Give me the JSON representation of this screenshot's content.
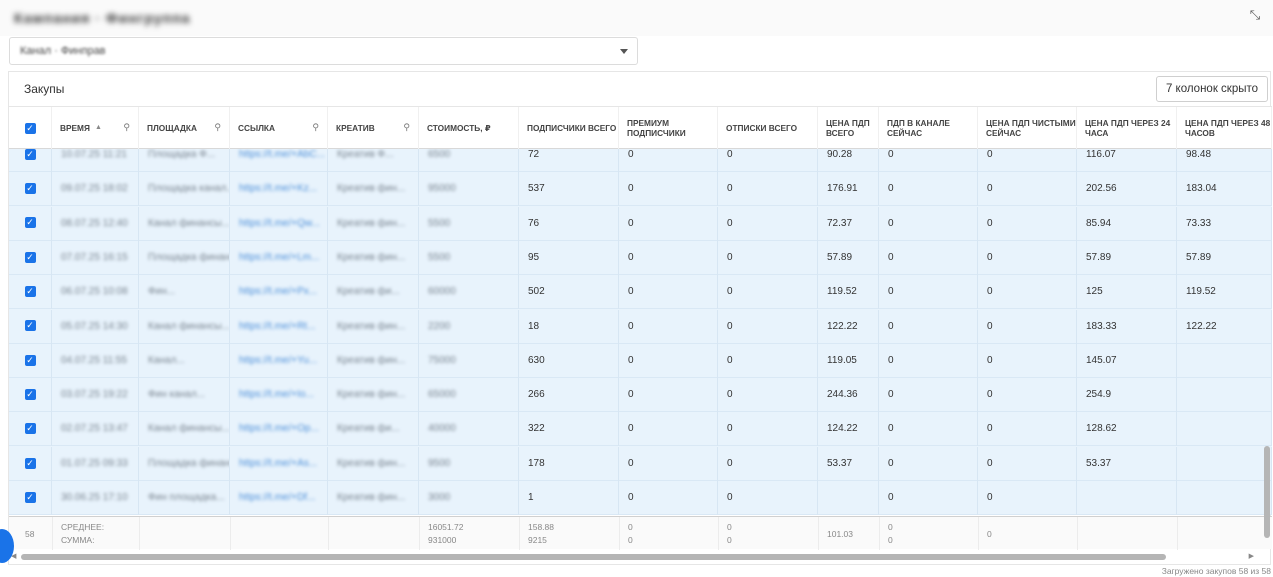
{
  "window": {
    "title": "Кампания · Фингруппа"
  },
  "channel_select": {
    "value": "Канал · Финправ"
  },
  "panel": {
    "title": "Закупы",
    "hidden_columns_button": "7 колонок скрыто"
  },
  "columns": [
    {
      "key": "select",
      "label": ""
    },
    {
      "key": "time",
      "label": "ВРЕМЯ",
      "sortable": true,
      "searchable": true
    },
    {
      "key": "platform",
      "label": "ПЛОЩАДКА",
      "searchable": true
    },
    {
      "key": "link",
      "label": "ССЫЛКА",
      "searchable": true
    },
    {
      "key": "creative",
      "label": "КРЕАТИВ",
      "searchable": true
    },
    {
      "key": "cost",
      "label": "СТОИМОСТЬ, ₽"
    },
    {
      "key": "subs_total",
      "label": "ПОДПИСЧИКИ ВСЕГО"
    },
    {
      "key": "premium",
      "label": "ПРЕМИУМ ПОДПИСЧИКИ"
    },
    {
      "key": "unsubs",
      "label": "ОТПИСКИ ВСЕГО"
    },
    {
      "key": "cpf_total",
      "label": "ЦЕНА ПДП ВСЕГО"
    },
    {
      "key": "pdp_now",
      "label": "ПДП В КАНАЛЕ СЕЙЧАС"
    },
    {
      "key": "cpf_net",
      "label": "ЦЕНА ПДП ЧИСТЫМИ СЕЙЧАС"
    },
    {
      "key": "cpf_24",
      "label": "ЦЕНА ПДП ЧЕРЕЗ 24 ЧАСА"
    },
    {
      "key": "cpf_48",
      "label": "ЦЕНА ПДП ЧЕРЕЗ 48 ЧАСОВ"
    }
  ],
  "rows": [
    {
      "time": "10.07.25 11:21",
      "platform": "Площадка Ф...",
      "link": "https://t.me/+AbC...",
      "creative": "Креатив Ф...",
      "cost": "6500",
      "subs_total": "72",
      "premium": "0",
      "unsubs": "0",
      "cpf_total": "90.28",
      "pdp_now": "0",
      "cpf_net": "0",
      "cpf_24": "116.07",
      "cpf_48": "98.48"
    },
    {
      "time": "09.07.25 18:02",
      "platform": "Площадка канал...",
      "link": "https://t.me/+Kz...",
      "creative": "Креатив фин...",
      "cost": "95000",
      "subs_total": "537",
      "premium": "0",
      "unsubs": "0",
      "cpf_total": "176.91",
      "pdp_now": "0",
      "cpf_net": "0",
      "cpf_24": "202.56",
      "cpf_48": "183.04"
    },
    {
      "time": "08.07.25 12:40",
      "platform": "Канал финансы...",
      "link": "https://t.me/+Qw...",
      "creative": "Креатив фин...",
      "cost": "5500",
      "subs_total": "76",
      "premium": "0",
      "unsubs": "0",
      "cpf_total": "72.37",
      "pdp_now": "0",
      "cpf_net": "0",
      "cpf_24": "85.94",
      "cpf_48": "73.33"
    },
    {
      "time": "07.07.25 16:15",
      "platform": "Площадка финанс...",
      "link": "https://t.me/+Lm...",
      "creative": "Креатив фин...",
      "cost": "5500",
      "subs_total": "95",
      "premium": "0",
      "unsubs": "0",
      "cpf_total": "57.89",
      "pdp_now": "0",
      "cpf_net": "0",
      "cpf_24": "57.89",
      "cpf_48": "57.89"
    },
    {
      "time": "06.07.25 10:08",
      "platform": "Фин...",
      "link": "https://t.me/+Px...",
      "creative": "Креатив фи...",
      "cost": "60000",
      "subs_total": "502",
      "premium": "0",
      "unsubs": "0",
      "cpf_total": "119.52",
      "pdp_now": "0",
      "cpf_net": "0",
      "cpf_24": "125",
      "cpf_48": "119.52"
    },
    {
      "time": "05.07.25 14:30",
      "platform": "Канал финансы...",
      "link": "https://t.me/+Rt...",
      "creative": "Креатив фин...",
      "cost": "2200",
      "subs_total": "18",
      "premium": "0",
      "unsubs": "0",
      "cpf_total": "122.22",
      "pdp_now": "0",
      "cpf_net": "0",
      "cpf_24": "183.33",
      "cpf_48": "122.22"
    },
    {
      "time": "04.07.25 11:55",
      "platform": "Канал...",
      "link": "https://t.me/+Yu...",
      "creative": "Креатив фин...",
      "cost": "75000",
      "subs_total": "630",
      "premium": "0",
      "unsubs": "0",
      "cpf_total": "119.05",
      "pdp_now": "0",
      "cpf_net": "0",
      "cpf_24": "145.07",
      "cpf_48": ""
    },
    {
      "time": "03.07.25 19:22",
      "platform": "Фин канал...",
      "link": "https://t.me/+Io...",
      "creative": "Креатив фин...",
      "cost": "65000",
      "subs_total": "266",
      "premium": "0",
      "unsubs": "0",
      "cpf_total": "244.36",
      "pdp_now": "0",
      "cpf_net": "0",
      "cpf_24": "254.9",
      "cpf_48": ""
    },
    {
      "time": "02.07.25 13:47",
      "platform": "Канал финансы...",
      "link": "https://t.me/+Op...",
      "creative": "Креатив фи...",
      "cost": "40000",
      "subs_total": "322",
      "premium": "0",
      "unsubs": "0",
      "cpf_total": "124.22",
      "pdp_now": "0",
      "cpf_net": "0",
      "cpf_24": "128.62",
      "cpf_48": ""
    },
    {
      "time": "01.07.25 09:33",
      "platform": "Площадка финанс...",
      "link": "https://t.me/+As...",
      "creative": "Креатив фин...",
      "cost": "9500",
      "subs_total": "178",
      "premium": "0",
      "unsubs": "0",
      "cpf_total": "53.37",
      "pdp_now": "0",
      "cpf_net": "0",
      "cpf_24": "53.37",
      "cpf_48": ""
    },
    {
      "time": "30.06.25 17:10",
      "platform": "Фин площадка...",
      "link": "https://t.me/+Df...",
      "creative": "Креатив фин...",
      "cost": "3000",
      "subs_total": "1",
      "premium": "0",
      "unsubs": "0",
      "cpf_total": "",
      "pdp_now": "0",
      "cpf_net": "0",
      "cpf_24": "",
      "cpf_48": ""
    }
  ],
  "footer": {
    "count": "58",
    "avg_label": "СРЕДНЕЕ:",
    "sum_label": "СУММА:",
    "cost_avg": "16051.72",
    "cost_sum": "931000",
    "subs_avg": "158.88",
    "subs_sum": "9215",
    "premium_avg": "0",
    "premium_sum": "0",
    "unsubs_avg": "0",
    "unsubs_sum": "0",
    "cpf_avg": "101.03",
    "pdp_avg": "0",
    "pdp_sum": "0",
    "net_avg": "0"
  },
  "status": {
    "loaded_text": "Загружено закупов 58 из 58"
  },
  "icons": {
    "close": "collapse-icon",
    "search": "search-icon",
    "sort": "sort-icon"
  },
  "colors": {
    "accent": "#1a73e8",
    "selected_row": "#e8f3fc"
  }
}
